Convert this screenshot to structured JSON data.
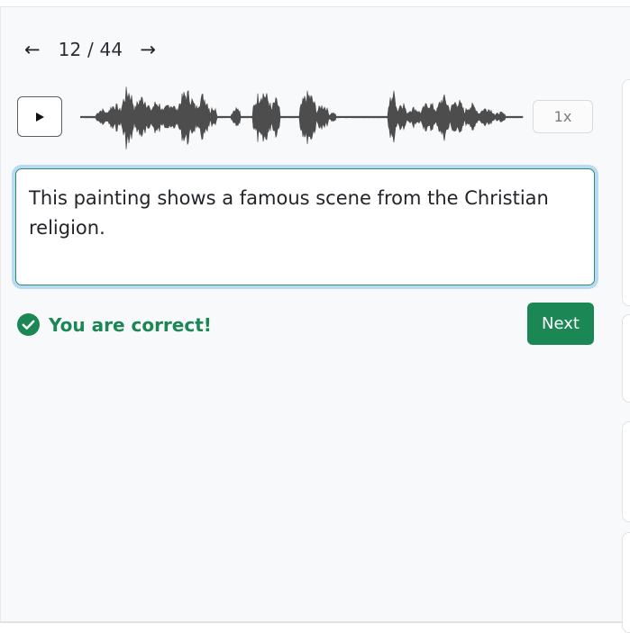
{
  "navigation": {
    "prev_icon": "←",
    "counter": "12 / 44",
    "next_icon": "→"
  },
  "audio": {
    "play_icon": "play-icon",
    "speed_label": "1x"
  },
  "answer": {
    "text": "This painting shows a famous scene from the Christian religion."
  },
  "feedback": {
    "icon": "check-circle-icon",
    "message": "You are correct!",
    "color": "#1b8754"
  },
  "actions": {
    "next_label": "Next"
  },
  "colors": {
    "accent_green": "#1b8754",
    "focus_ring": "#b9d9f7",
    "waveform": "#4d4d4d"
  }
}
